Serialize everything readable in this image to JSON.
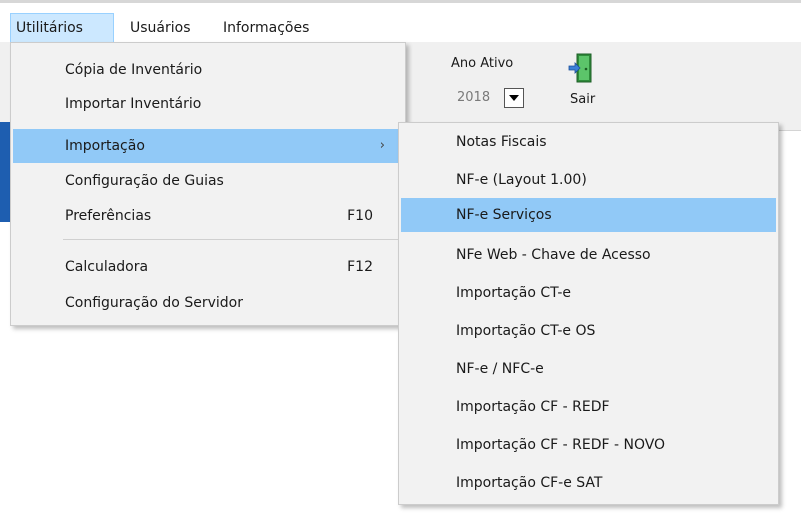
{
  "menubar": {
    "items": [
      {
        "label": "Utilitários"
      },
      {
        "label": "Usuários"
      },
      {
        "label": "Informações"
      }
    ]
  },
  "toolbar": {
    "ano_label": "Ano Ativo",
    "ano_value": "2018",
    "sair_label": "Sair"
  },
  "utilitarios_menu": {
    "items": [
      {
        "label": "Cópia de Inventário",
        "shortcut": ""
      },
      {
        "label": "Importar Inventário",
        "shortcut": ""
      },
      {
        "label": "Importação",
        "shortcut": "",
        "submenu_arrow": "›"
      },
      {
        "label": "Configuração de Guias",
        "shortcut": ""
      },
      {
        "label": "Preferências",
        "shortcut": "F10"
      },
      {
        "label": "Calculadora",
        "shortcut": "F12"
      },
      {
        "label": "Configuração do Servidor",
        "shortcut": ""
      }
    ]
  },
  "importacao_submenu": {
    "items": [
      {
        "label": "Notas Fiscais"
      },
      {
        "label": "NF-e (Layout 1.00)"
      },
      {
        "label": "NF-e Serviços"
      },
      {
        "label": "NFe Web - Chave de Acesso"
      },
      {
        "label": "Importação CT-e"
      },
      {
        "label": "Importação CT-e OS"
      },
      {
        "label": "NF-e / NFC-e"
      },
      {
        "label": "Importação CF - REDF"
      },
      {
        "label": "Importação CF - REDF - NOVO"
      },
      {
        "label": "Importação CF-e SAT"
      }
    ]
  },
  "icons": {
    "sair": "exit-door-icon",
    "dropdown": "chevron-down-icon"
  },
  "colors": {
    "menu_highlight": "#91c9f7",
    "menubar_active": "#cce8ff"
  }
}
